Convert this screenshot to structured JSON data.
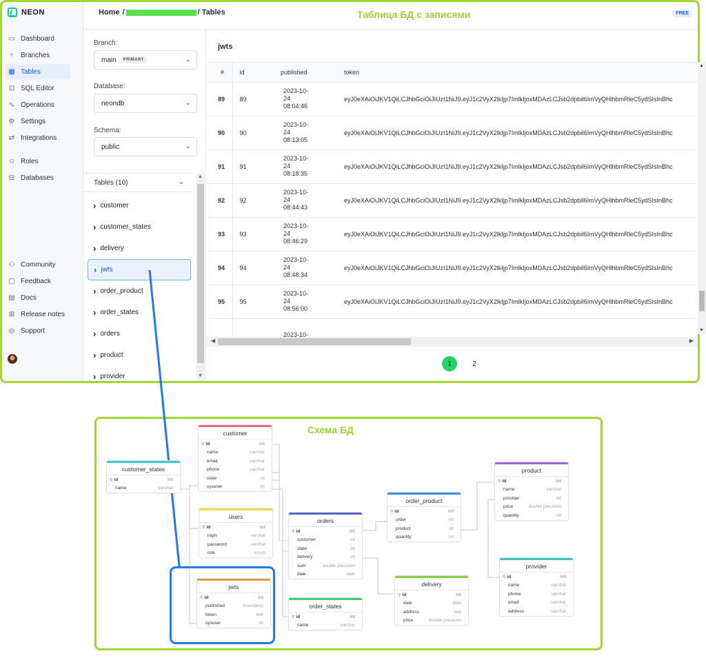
{
  "app": {
    "logo_text": "NEON",
    "breadcrumb": {
      "home": "Home",
      "separator": "/",
      "suffix": "/ Tables"
    },
    "annotation_top": "Таблица БД с записями",
    "plan_badge": "FREE"
  },
  "sidebar": {
    "items": [
      {
        "label": "Dashboard",
        "icon": "dashboard-icon",
        "glyph": "▭"
      },
      {
        "label": "Branches",
        "icon": "branch-icon",
        "glyph": "⑂"
      },
      {
        "label": "Tables",
        "icon": "table-icon",
        "glyph": "▦"
      },
      {
        "label": "SQL Editor",
        "icon": "sql-editor-icon",
        "glyph": "⊡"
      },
      {
        "label": "Operations",
        "icon": "operations-icon",
        "glyph": "∿"
      },
      {
        "label": "Settings",
        "icon": "gear-icon",
        "glyph": "⚙"
      },
      {
        "label": "Integrations",
        "icon": "integrations-icon",
        "glyph": "⇄"
      },
      {
        "label": "Roles",
        "icon": "roles-icon",
        "glyph": "☺"
      },
      {
        "label": "Databases",
        "icon": "database-icon",
        "glyph": "⊟"
      }
    ],
    "bottom_items": [
      {
        "label": "Community",
        "icon": "community-icon",
        "glyph": "⚇"
      },
      {
        "label": "Feedback",
        "icon": "feedback-icon",
        "glyph": "▢"
      },
      {
        "label": "Docs",
        "icon": "docs-icon",
        "glyph": "▤"
      },
      {
        "label": "Release notes",
        "icon": "release-notes-icon",
        "glyph": "⊞"
      },
      {
        "label": "Support",
        "icon": "support-icon",
        "glyph": "◎"
      }
    ],
    "active": "Tables"
  },
  "filters": {
    "branch_label": "Branch:",
    "branch_value": "main",
    "branch_tag": "PRIMARY",
    "database_label": "Database:",
    "database_value": "neondb",
    "schema_label": "Schema:",
    "schema_value": "public",
    "tables_header": "Tables (10)",
    "tables": [
      "customer",
      "customer_states",
      "delivery",
      "jwts",
      "order_product",
      "order_states",
      "orders",
      "product",
      "provider"
    ],
    "active_table": "jwts"
  },
  "grid": {
    "title": "jwts",
    "columns": [
      "#",
      "id",
      "published",
      "token"
    ],
    "token_preview": "eyJ0eXAiOiJKV1QiLCJhbGciOiJIUzI1NiJ9.eyJ1c2VyX2lkIjp7ImlkIjoxMDAzLCJsb2dpbiI6ImVyQHlhbmRleC5ydSIsInBhc",
    "rows": [
      {
        "num": "89",
        "id": "89",
        "date": "2023-10-",
        "day": "24",
        "time": "08:04:46"
      },
      {
        "num": "90",
        "id": "90",
        "date": "2023-10-",
        "day": "24",
        "time": "08:13:05"
      },
      {
        "num": "91",
        "id": "91",
        "date": "2023-10-",
        "day": "24",
        "time": "08:18:35"
      },
      {
        "num": "92",
        "id": "92",
        "date": "2023-10-",
        "day": "24",
        "time": "08:44:43"
      },
      {
        "num": "93",
        "id": "93",
        "date": "2023-10-",
        "day": "24",
        "time": "08:46:29"
      },
      {
        "num": "94",
        "id": "94",
        "date": "2023-10-",
        "day": "24",
        "time": "08:48:34"
      },
      {
        "num": "95",
        "id": "95",
        "date": "2023-10-",
        "day": "24",
        "time": "08:56:00"
      },
      {
        "num": "",
        "id": "",
        "date": "2023-10-",
        "day": "",
        "time": ""
      }
    ],
    "pages": [
      "1",
      "2"
    ],
    "current_page": "1"
  },
  "schema": {
    "title": "Схема БД",
    "key_glyph": "⚲",
    "entities": [
      {
        "id": "customer",
        "name": "customer",
        "color": "#e86a8e",
        "fields": [
          [
            "id",
            "int"
          ],
          [
            "name",
            "varchar"
          ],
          [
            "email",
            "varchar"
          ],
          [
            "phone",
            "varchar"
          ],
          [
            "state",
            "int"
          ],
          [
            "sysuser",
            "int"
          ]
        ]
      },
      {
        "id": "customer_states",
        "name": "customer_states",
        "color": "#3fc7d8",
        "fields": [
          [
            "id",
            "int"
          ],
          [
            "name",
            "varchar"
          ]
        ]
      },
      {
        "id": "users",
        "name": "users",
        "color": "#f2dd4b",
        "fields": [
          [
            "id",
            "int"
          ],
          [
            "login",
            "varchar"
          ],
          [
            "password",
            "varchar"
          ],
          [
            "role",
            "enum"
          ]
        ]
      },
      {
        "id": "jwts",
        "name": "jwts",
        "color": "#f0974a",
        "fields": [
          [
            "id",
            "int"
          ],
          [
            "published",
            "timestamp"
          ],
          [
            "token",
            "text"
          ],
          [
            "sysuser",
            "int"
          ]
        ]
      },
      {
        "id": "orders",
        "name": "orders",
        "color": "#5a66c9",
        "fields": [
          [
            "id",
            "int"
          ],
          [
            "customer",
            "int"
          ],
          [
            "state",
            "int"
          ],
          [
            "delivery",
            "int"
          ],
          [
            "sum",
            "double precision"
          ],
          [
            "date",
            "date"
          ]
        ]
      },
      {
        "id": "order_states",
        "name": "order_states",
        "color": "#3fcf7d",
        "fields": [
          [
            "id",
            "int"
          ],
          [
            "name",
            "varchar"
          ]
        ]
      },
      {
        "id": "order_product",
        "name": "order_product",
        "color": "#3a8fde",
        "fields": [
          [
            "id",
            "int"
          ],
          [
            "order",
            "int"
          ],
          [
            "product",
            "int"
          ],
          [
            "quantity",
            "int"
          ]
        ]
      },
      {
        "id": "delivery",
        "name": "delivery",
        "color": "#7ed23a",
        "fields": [
          [
            "id",
            "int"
          ],
          [
            "date",
            "date"
          ],
          [
            "address",
            "text"
          ],
          [
            "price",
            "double precision"
          ]
        ]
      },
      {
        "id": "product",
        "name": "product",
        "color": "#9a6ad8",
        "fields": [
          [
            "id",
            "int"
          ],
          [
            "name",
            "varchar"
          ],
          [
            "provider",
            "int"
          ],
          [
            "price",
            "double precision"
          ],
          [
            "quantity",
            "int"
          ]
        ]
      },
      {
        "id": "provider",
        "name": "provider",
        "color": "#3fc7b8",
        "fields": [
          [
            "id",
            "int"
          ],
          [
            "name",
            "varchar"
          ],
          [
            "phone",
            "varchar"
          ],
          [
            "email",
            "varchar"
          ],
          [
            "address",
            "varchar"
          ]
        ]
      }
    ]
  },
  "colors": {
    "annotation_green": "#a3d635",
    "highlight_blue": "#1f7ae8",
    "active_page": "#22d36a"
  }
}
